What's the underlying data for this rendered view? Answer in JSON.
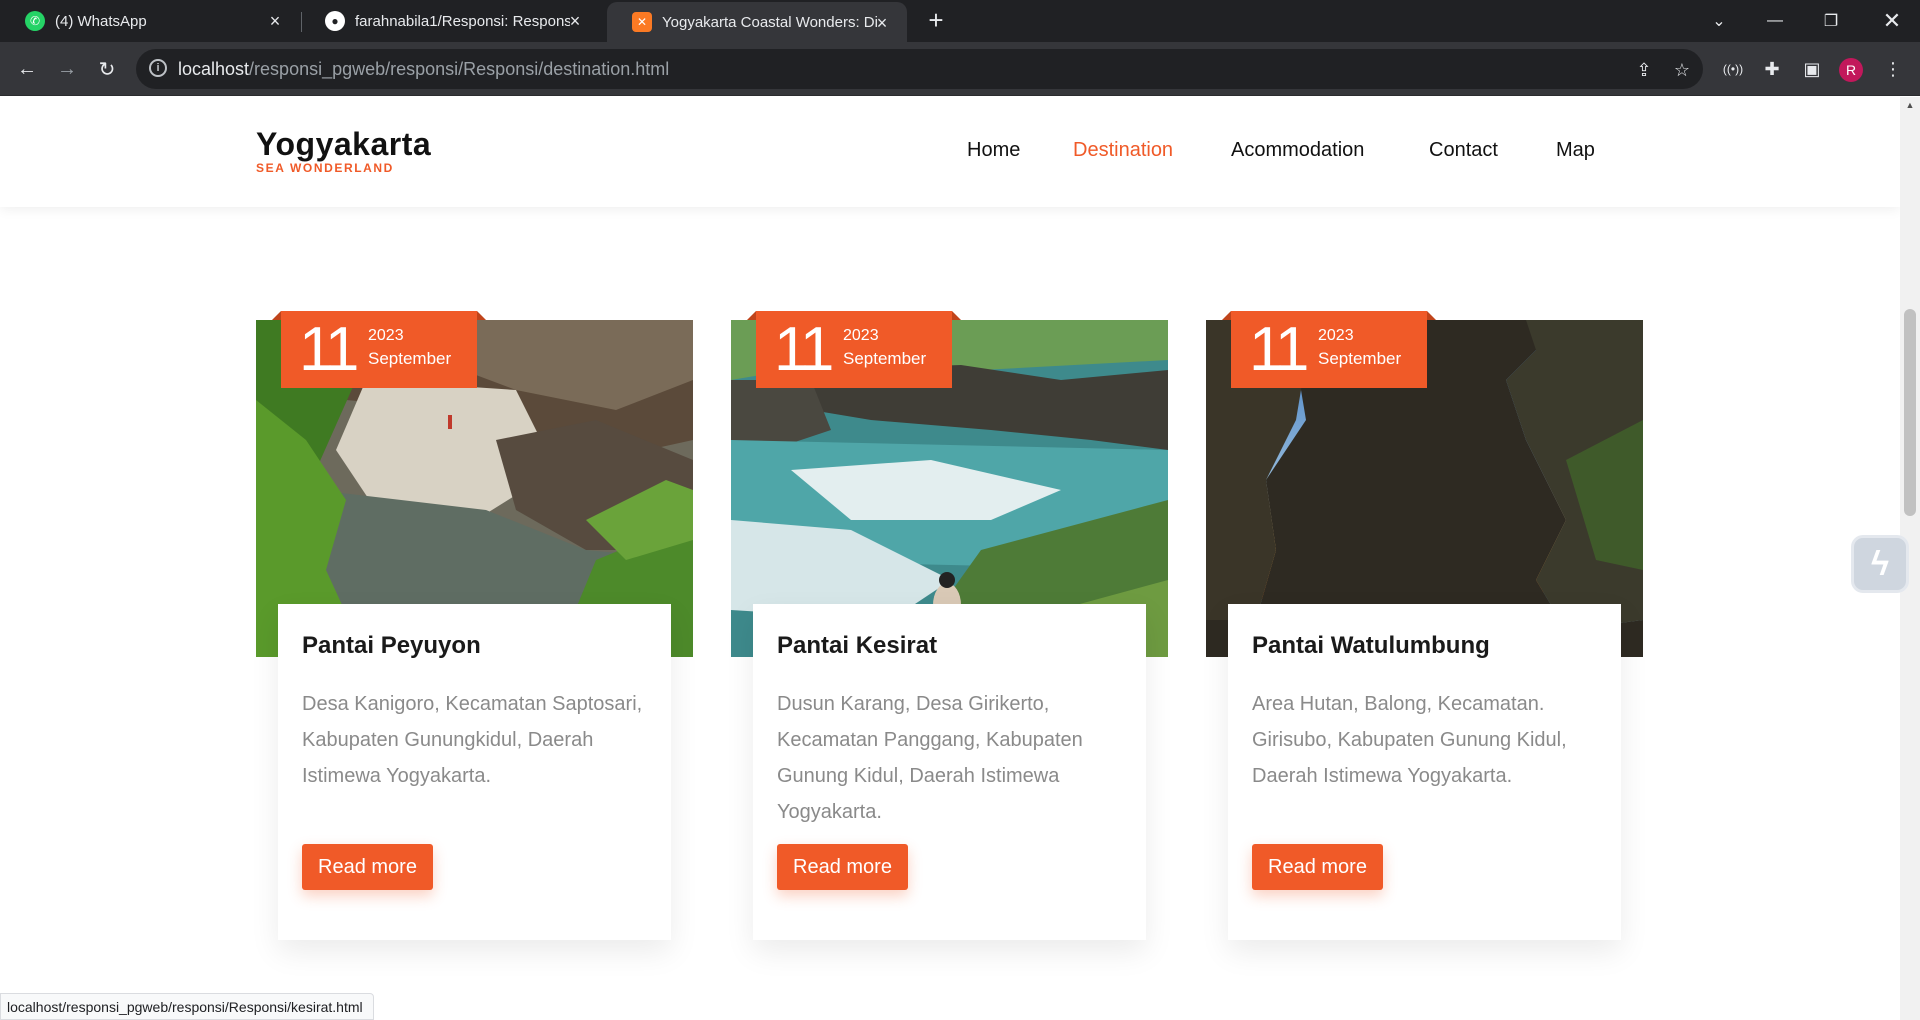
{
  "browser": {
    "tabs": [
      {
        "title": "(4) WhatsApp",
        "favicon": "whatsapp-icon",
        "active": false
      },
      {
        "title": "farahnabila1/Responsi: Responsi",
        "favicon": "github-icon",
        "active": false
      },
      {
        "title": "Yogyakarta Coastal Wonders: Di",
        "favicon": "xampp-icon",
        "active": true
      }
    ],
    "url_host": "localhost",
    "url_path": "/responsi_pgweb/responsi/Responsi/destination.html",
    "profile_initial": "R",
    "status_url": "localhost/responsi_pgweb/responsi/Responsi/kesirat.html"
  },
  "site": {
    "brand": "Yogyakarta",
    "tagline": "SEA WONDERLAND",
    "accent_color": "#f05a28",
    "nav": [
      {
        "label": "Home",
        "active": false
      },
      {
        "label": "Destination",
        "active": true
      },
      {
        "label": "Acommodation",
        "active": false
      },
      {
        "label": "Contact",
        "active": false
      },
      {
        "label": "Map",
        "active": false
      }
    ]
  },
  "destinations": [
    {
      "day": "11",
      "year": "2023",
      "month": "September",
      "name": "Pantai Peyuyon",
      "address": "Desa Kanigoro, Kecamatan Saptosari, Kabupaten Gunungkidul, Daerah Istimewa Yogyakarta.",
      "button": "Read more",
      "image": "rocky-beach-photo"
    },
    {
      "day": "11",
      "year": "2023",
      "month": "September",
      "name": "Pantai Kesirat",
      "address": "Dusun Karang, Desa Girikerto, Kecamatan Panggang, Kabupaten Gunung Kidul, Daerah Istimewa Yogyakarta.",
      "button": "Read more",
      "image": "cliff-waves-photo"
    },
    {
      "day": "11",
      "year": "2023",
      "month": "September",
      "name": "Pantai Watulumbung",
      "address": "Area Hutan, Balong, Kecamatan. Girisubo, Kabupaten Gunung Kidul, Daerah Istimewa Yogyakarta.",
      "button": "Read more",
      "image": "cave-sunset-photo"
    }
  ]
}
